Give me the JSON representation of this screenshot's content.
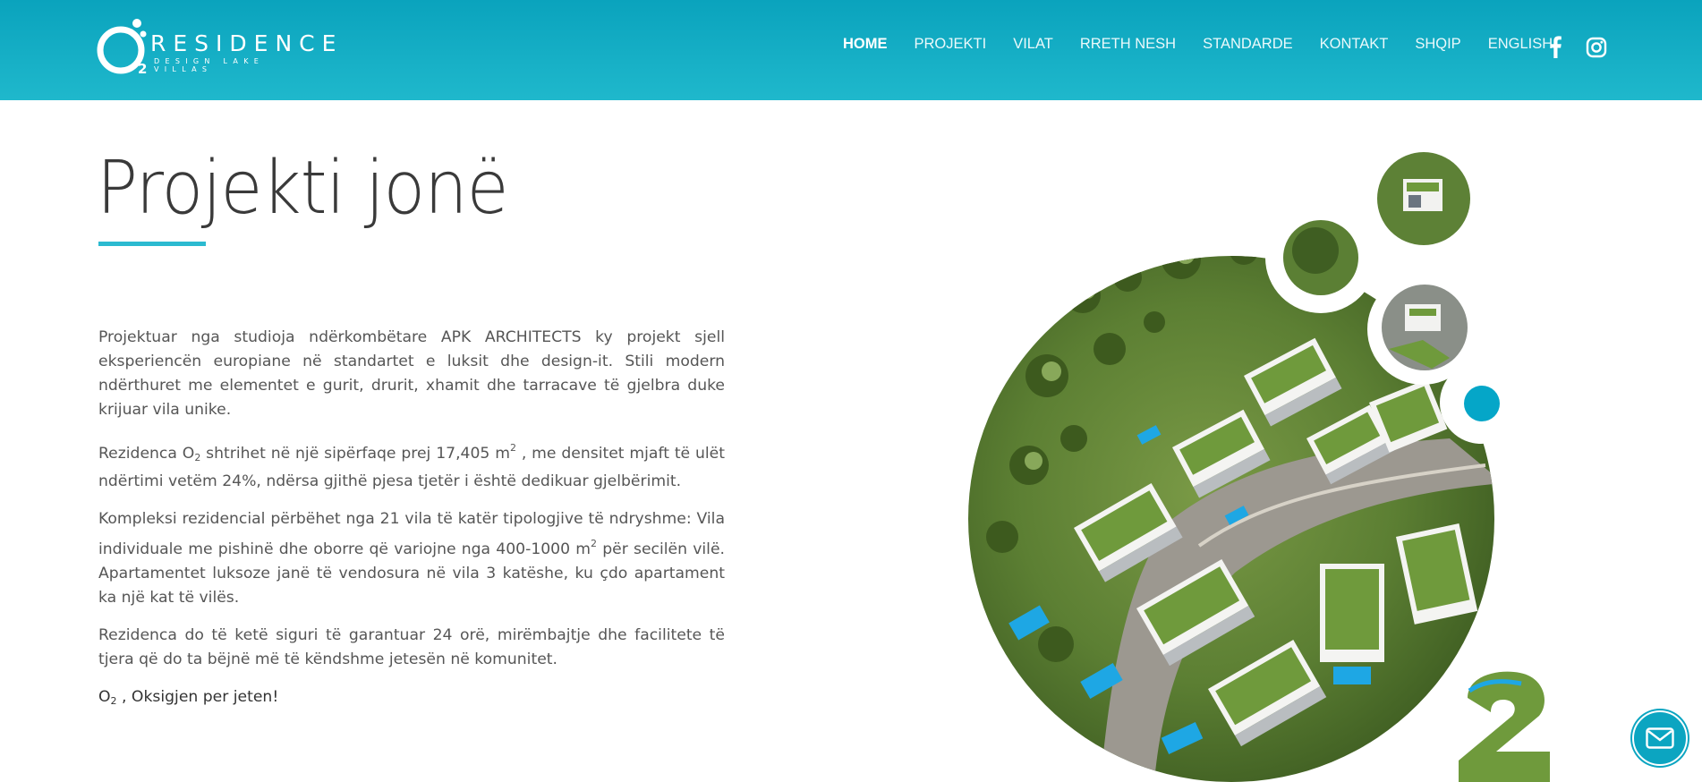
{
  "brand": {
    "logo_mark": "O2",
    "name": "RESIDENCE",
    "tagline": "DESIGN LAKE VILLAS"
  },
  "nav": {
    "items": [
      {
        "label": "HOME",
        "active": true
      },
      {
        "label": "PROJEKTI",
        "active": false
      },
      {
        "label": "VILAT",
        "active": false
      },
      {
        "label": "RRETH NESH",
        "active": false
      },
      {
        "label": "STANDARDE",
        "active": false
      },
      {
        "label": "KONTAKT",
        "active": false
      },
      {
        "label": "SHQIP",
        "active": false
      },
      {
        "label": "ENGLISH",
        "active": false
      }
    ],
    "social": [
      "facebook-icon",
      "instagram-icon"
    ]
  },
  "main": {
    "title": "Projekti jonë",
    "p1": "Projektuar nga studioja ndërkombëtare APK ARCHITECTS ky projekt sjell eksperiencën europiane në standartet e luksit dhe design-it. Stili modern ndërthuret me elementet e gurit, drurit, xhamit dhe tarracave të gjelbra duke krijuar vila unike.",
    "p2_a": "Rezidenca O",
    "p2_sub": "2",
    "p2_b": " shtrihet në një sipërfaqe prej 17,405  m",
    "p2_sup": "2",
    "p2_c": " , me densitet mjaft të ulët ndërtimi vetëm 24%, ndërsa gjithë pjesa tjetër i është dedikuar gjelbërimit.",
    "p3_a": "Kompleksi rezidencial përbëhet nga 21 vila të katër tipologjive të ndryshme: Vila individuale me pishinë dhe oborre që variojne nga 400-1000  m",
    "p3_sup": "2",
    "p3_b": " për secilën vilë. Apartamentet luksoze janë të vendosura në vila 3 katëshe, ku çdo apartament ka një kat të vilës.",
    "p4": "Rezidenca do të ketë siguri të garantuar 24 orë, mirëmbajtje dhe facilitete të tjera që do ta bëjnë më të këndshme jetesën në komunitet.",
    "p5_a": "O",
    "p5_sub": "2",
    "p5_b": " , Oksigjen per jeten!"
  },
  "colors": {
    "header": "#14aec6",
    "accent": "#2bbad0",
    "bubble": "#05a6c8"
  },
  "contact_button": "mail-icon"
}
